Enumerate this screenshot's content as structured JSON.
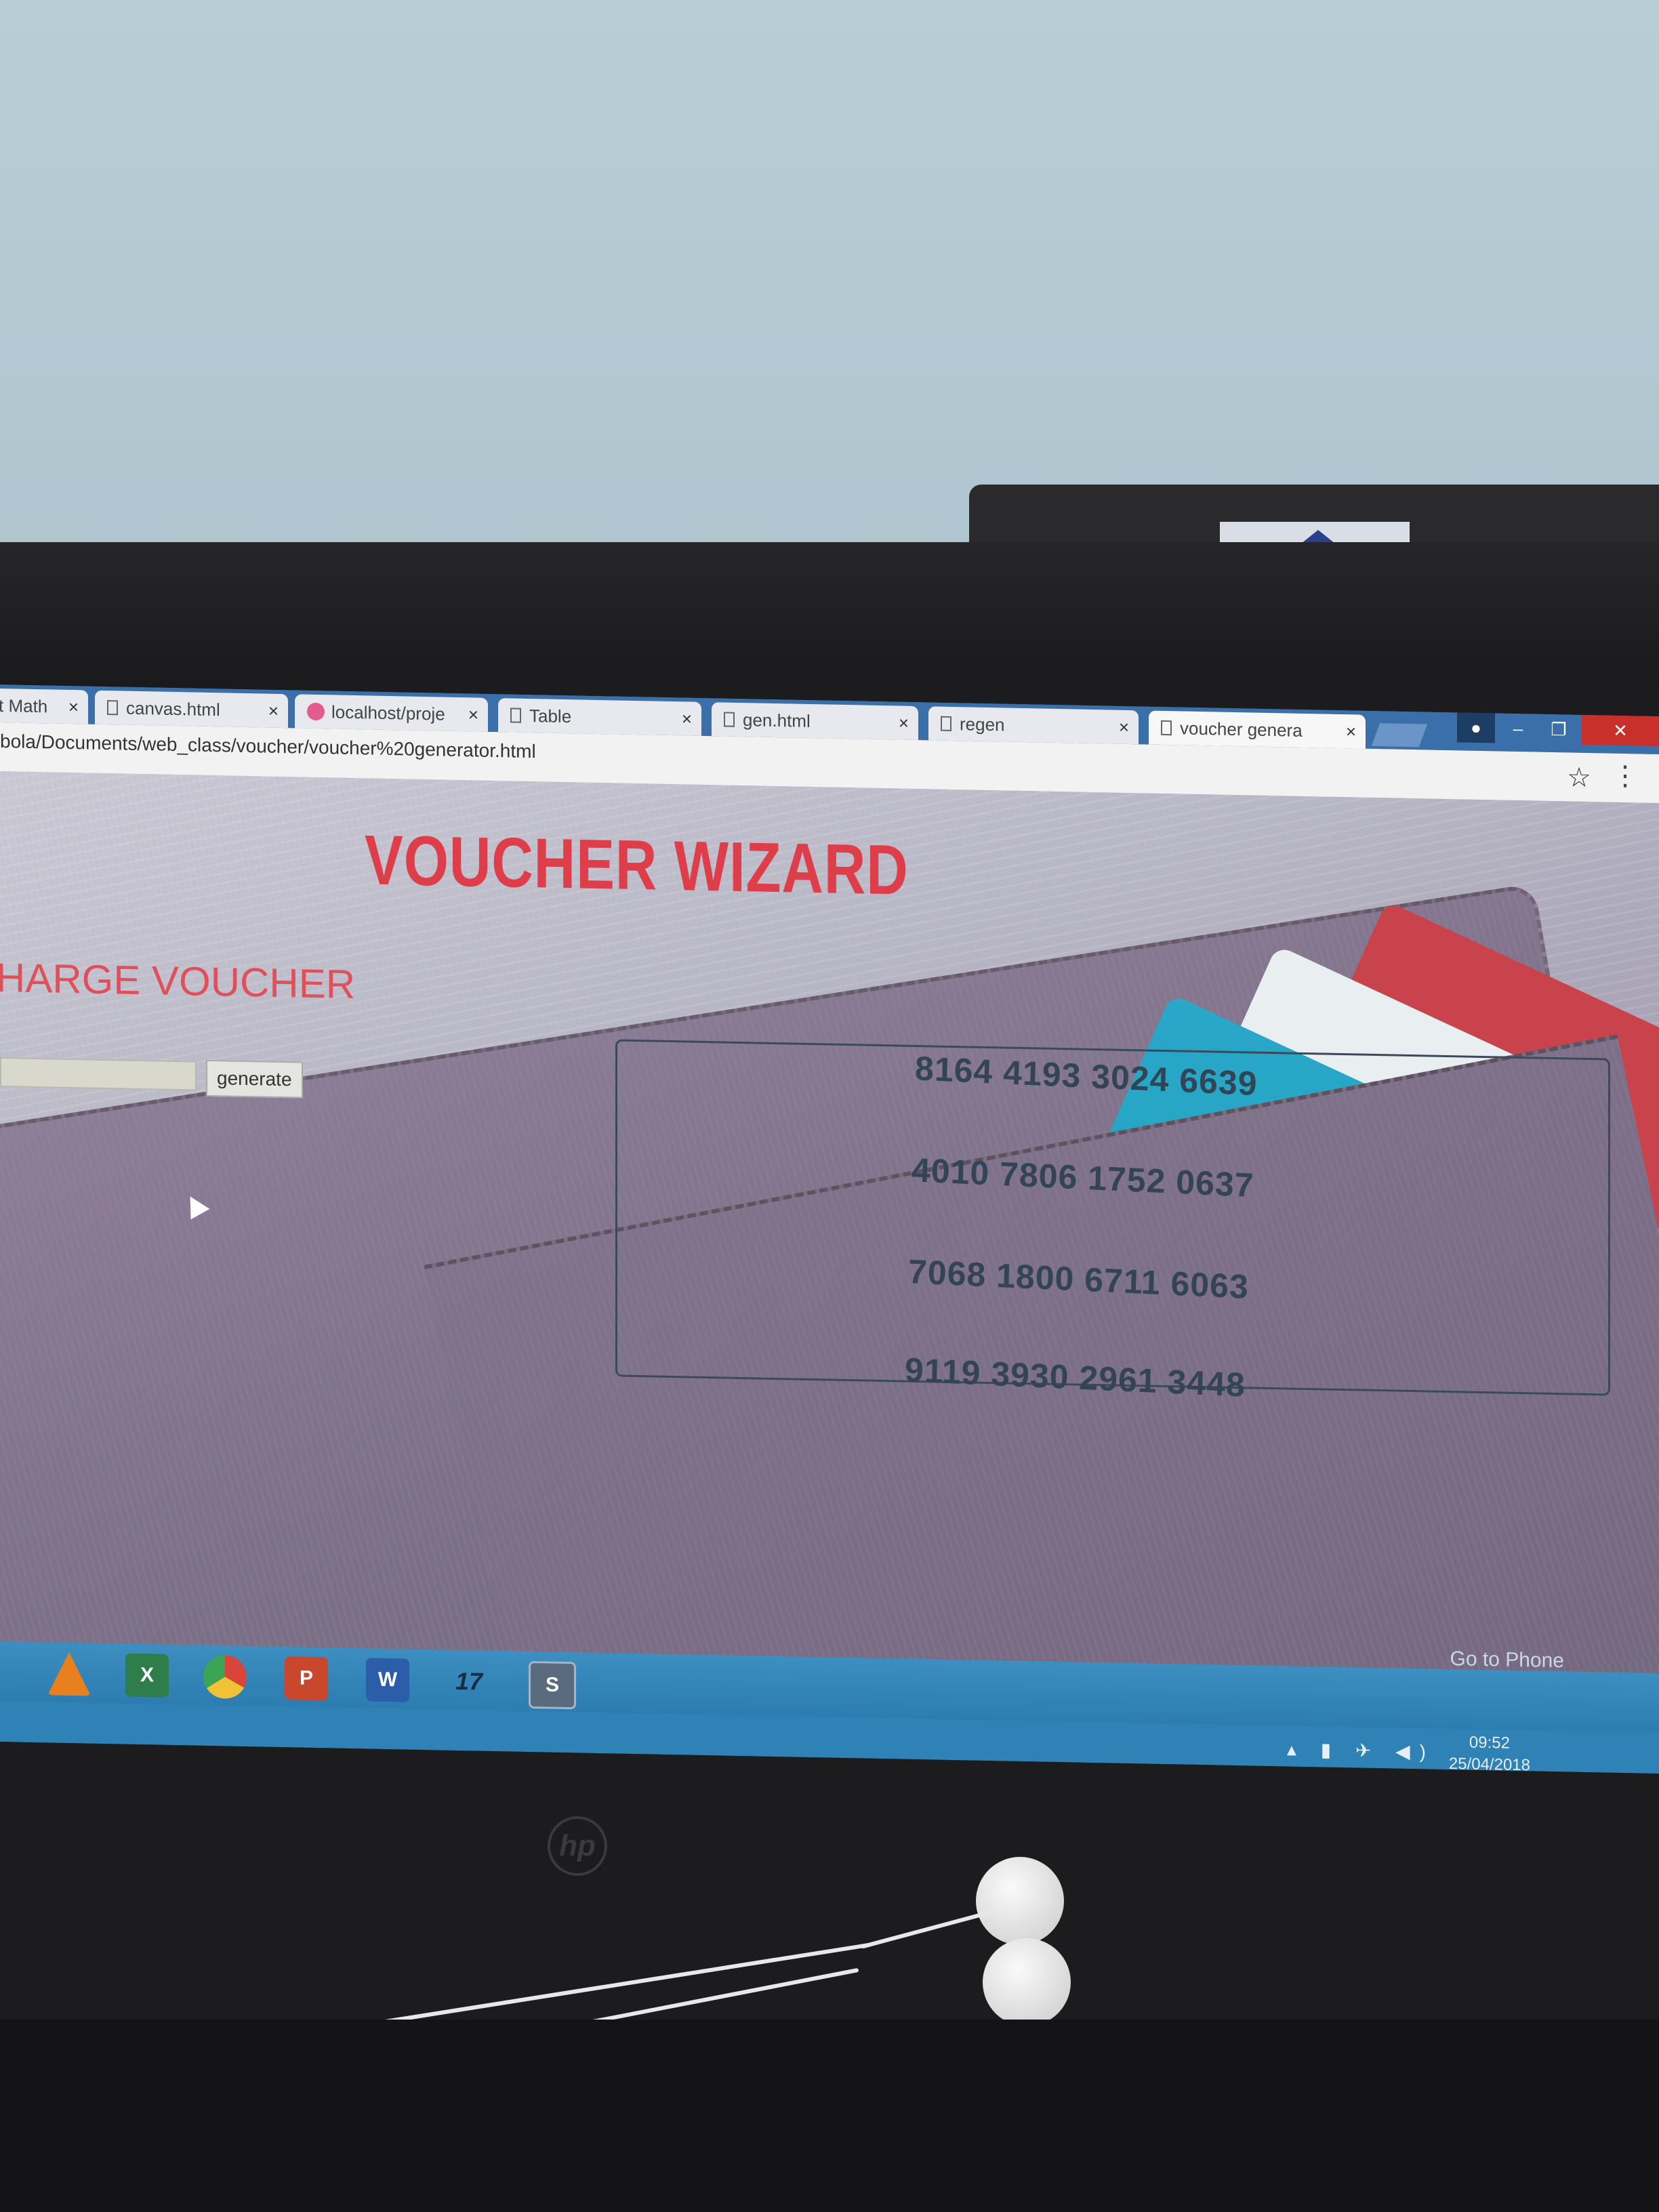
{
  "browser": {
    "tabs": [
      {
        "label": "t Math"
      },
      {
        "label": "canvas.html"
      },
      {
        "label": "localhost/proje"
      },
      {
        "label": "Table"
      },
      {
        "label": "gen.html"
      },
      {
        "label": "regen"
      },
      {
        "label": "voucher genera"
      }
    ],
    "close_glyph": "×",
    "url": "bola/Documents/web_class/voucher/voucher%20generator.html",
    "star_glyph": "☆",
    "menu_glyph": "⋮",
    "window_controls": {
      "minimize": "–",
      "maximize": "❐",
      "close": "✕"
    }
  },
  "page": {
    "title": "VOUCHER WIZARD",
    "subtitle": "HARGE VOUCHER",
    "generate_button": "generate",
    "input_value": "",
    "vouchers": [
      "8164 4193 3024 6639",
      "4010 7806 1752 0637",
      "7068 1800 6711 6063",
      "9119 3930 2961 3448"
    ]
  },
  "taskbar": {
    "icons": [
      "vlc-icon",
      "excel-icon",
      "chrome-icon",
      "powerpoint-icon",
      "word-icon",
      "app-17-icon",
      "sublime-icon"
    ],
    "app_17_label": "17",
    "goto_phone": "Go to Phone",
    "time": "09:52",
    "date": "25/04/2018"
  },
  "colors": {
    "title": "#de3d4a",
    "voucher_text": "#334457",
    "taskbar": "#2c7caf"
  }
}
